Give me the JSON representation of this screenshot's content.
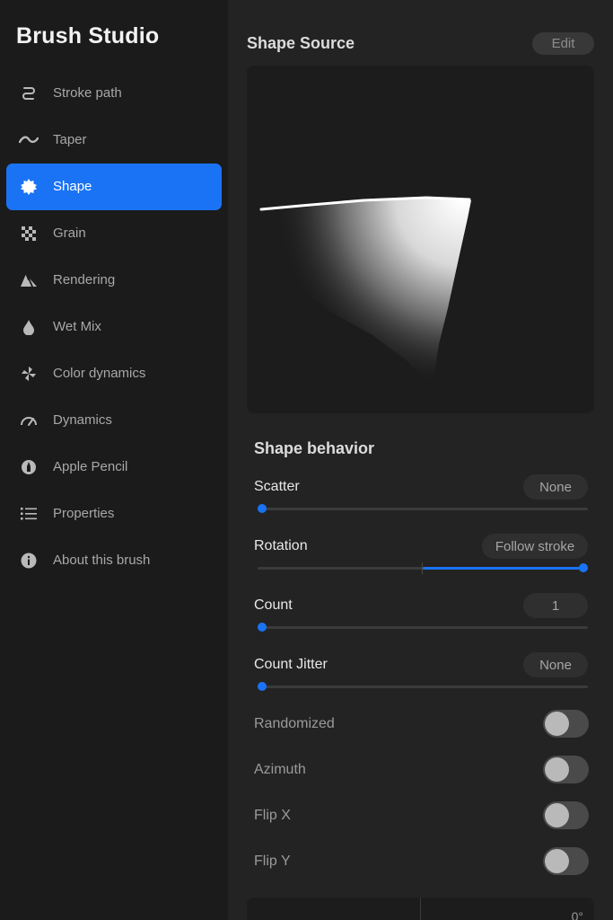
{
  "app": {
    "title": "Brush Studio"
  },
  "sidebar": {
    "items": [
      {
        "label": "Stroke path",
        "icon": "stroke-path-icon"
      },
      {
        "label": "Taper",
        "icon": "taper-icon"
      },
      {
        "label": "Shape",
        "icon": "shape-icon",
        "active": true
      },
      {
        "label": "Grain",
        "icon": "grain-icon"
      },
      {
        "label": "Rendering",
        "icon": "rendering-icon"
      },
      {
        "label": "Wet Mix",
        "icon": "wet-mix-icon"
      },
      {
        "label": "Color dynamics",
        "icon": "color-dynamics-icon"
      },
      {
        "label": "Dynamics",
        "icon": "dynamics-icon"
      },
      {
        "label": "Apple Pencil",
        "icon": "apple-pencil-icon"
      },
      {
        "label": "Properties",
        "icon": "properties-icon"
      },
      {
        "label": "About this brush",
        "icon": "info-icon"
      }
    ]
  },
  "shape_source": {
    "title": "Shape Source",
    "edit_label": "Edit"
  },
  "shape_behavior": {
    "title": "Shape behavior",
    "scatter": {
      "label": "Scatter",
      "value": "None",
      "level": 0.0
    },
    "rotation": {
      "label": "Rotation",
      "value": "Follow stroke",
      "level": 1.0
    },
    "count": {
      "label": "Count",
      "value": "1",
      "level": 0.0
    },
    "count_jitter": {
      "label": "Count Jitter",
      "value": "None",
      "level": 0.0
    },
    "toggles": [
      {
        "label": "Randomized",
        "on": false
      },
      {
        "label": "Azimuth",
        "on": false
      },
      {
        "label": "Flip X",
        "on": false
      },
      {
        "label": "Flip Y",
        "on": false
      }
    ],
    "bottom_value": "0°"
  },
  "colors": {
    "accent": "#1a73f4",
    "background": "#232323",
    "sidebar": "#1b1b1b"
  }
}
